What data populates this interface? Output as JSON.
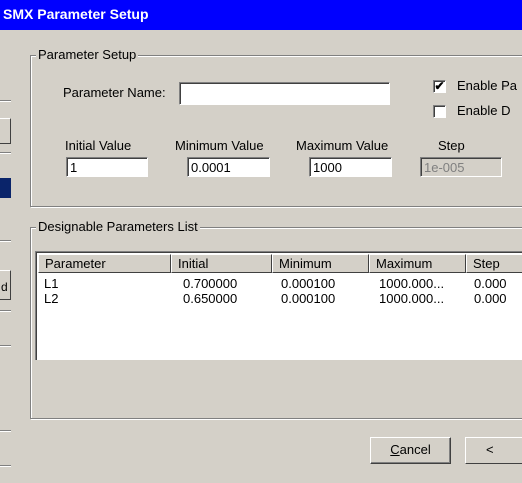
{
  "window": {
    "title": "SMX Parameter Setup"
  },
  "background_window": {
    "letter": "d"
  },
  "parameter_setup": {
    "group_label": "Parameter Setup",
    "name_label": "Parameter Name:",
    "name_value": "",
    "enable_parameter": {
      "label": "Enable Pa",
      "checked": true,
      "mark": "✔"
    },
    "enable_design": {
      "label": "Enable D",
      "checked": false,
      "mark": ""
    },
    "initial": {
      "label": "Initial Value",
      "value": "1"
    },
    "minimum": {
      "label": "Minimum Value",
      "value": "0.0001"
    },
    "maximum": {
      "label": "Maximum Value",
      "value": "1000"
    },
    "step": {
      "label": "Step",
      "value": "1e-005"
    }
  },
  "designable_list": {
    "group_label": "Designable Parameters List",
    "columns": [
      "Parameter",
      "Initial",
      "Minimum",
      "Maximum",
      "Step"
    ],
    "rows": [
      [
        "L1",
        "0.700000",
        "0.000100",
        "1000.000...",
        "0.000"
      ],
      [
        "L2",
        "0.650000",
        "0.000100",
        "1000.000...",
        "0.000"
      ]
    ]
  },
  "buttons": {
    "cancel": {
      "prefix": "",
      "mnemonic": "C",
      "rest": "ancel"
    },
    "next": "<"
  }
}
